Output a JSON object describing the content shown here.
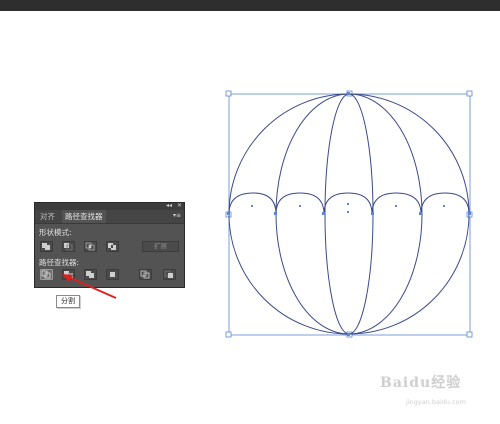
{
  "panel": {
    "tabs": [
      {
        "label": "对齐",
        "active": false
      },
      {
        "label": "路径查找器",
        "active": true
      }
    ],
    "shape_modes_label": "形状模式:",
    "pathfinders_label": "路径查找器:",
    "expand_label": "扩展",
    "controls": {
      "collapse": "◂◂",
      "close": "✕",
      "menu": "▾≡"
    }
  },
  "tooltip": {
    "text": "分割"
  },
  "colors": {
    "panel_bg": "#535353",
    "artwork_stroke": "#3b4a8a",
    "selection_blue": "#5b86d8",
    "arrow_red": "#e02020"
  },
  "watermark": {
    "text": "Baidu经验",
    "sub": "jingyan.baidu.com"
  }
}
